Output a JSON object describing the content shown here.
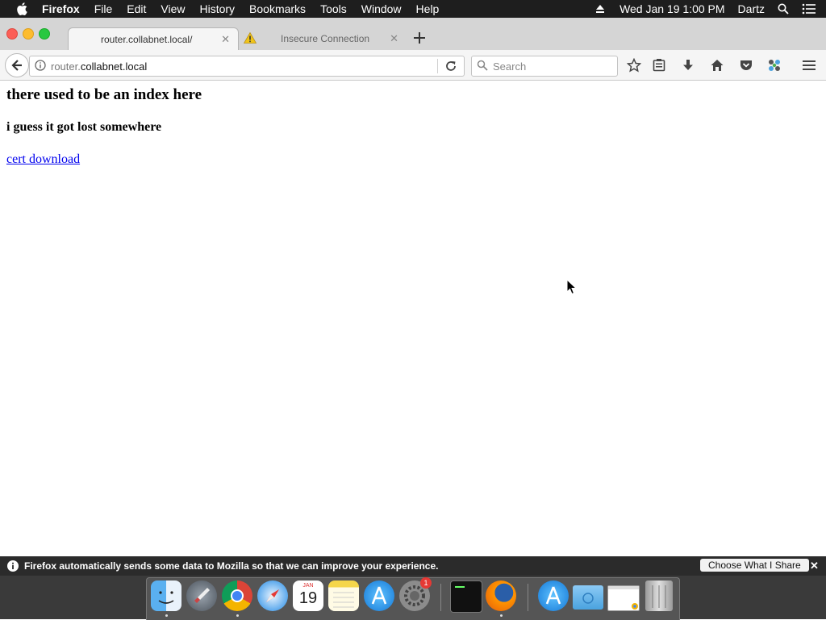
{
  "menubar": {
    "app": "Firefox",
    "items": [
      "File",
      "Edit",
      "View",
      "History",
      "Bookmarks",
      "Tools",
      "Window",
      "Help"
    ],
    "datetime": "Wed Jan 19  1:00 PM",
    "user": "Dartz"
  },
  "tabs": [
    {
      "title": "router.collabnet.local/",
      "active": true
    },
    {
      "title": "Insecure Connection",
      "active": false
    }
  ],
  "urlbar": {
    "prefix": "router.",
    "domain": "collabnet.local"
  },
  "search": {
    "placeholder": "Search"
  },
  "page": {
    "heading": "there used to be an index here",
    "subheading": "i guess it got lost somewhere",
    "link": "cert download"
  },
  "notification": {
    "message": "Firefox automatically sends some data to Mozilla so that we can improve your experience.",
    "button": "Choose What I Share"
  },
  "dock": {
    "calendar_month": "JAN",
    "calendar_day": "19",
    "badge_count": "1",
    "apps": [
      "finder-icon",
      "launchpad-icon",
      "chrome-icon",
      "safari-icon",
      "calendar-icon",
      "notes-icon",
      "app-store-icon",
      "system-preferences-icon",
      "terminal-icon",
      "firefox-icon",
      "app-store-folder-icon",
      "folder-icon",
      "window-thumbnail-icon",
      "trash-icon"
    ]
  }
}
